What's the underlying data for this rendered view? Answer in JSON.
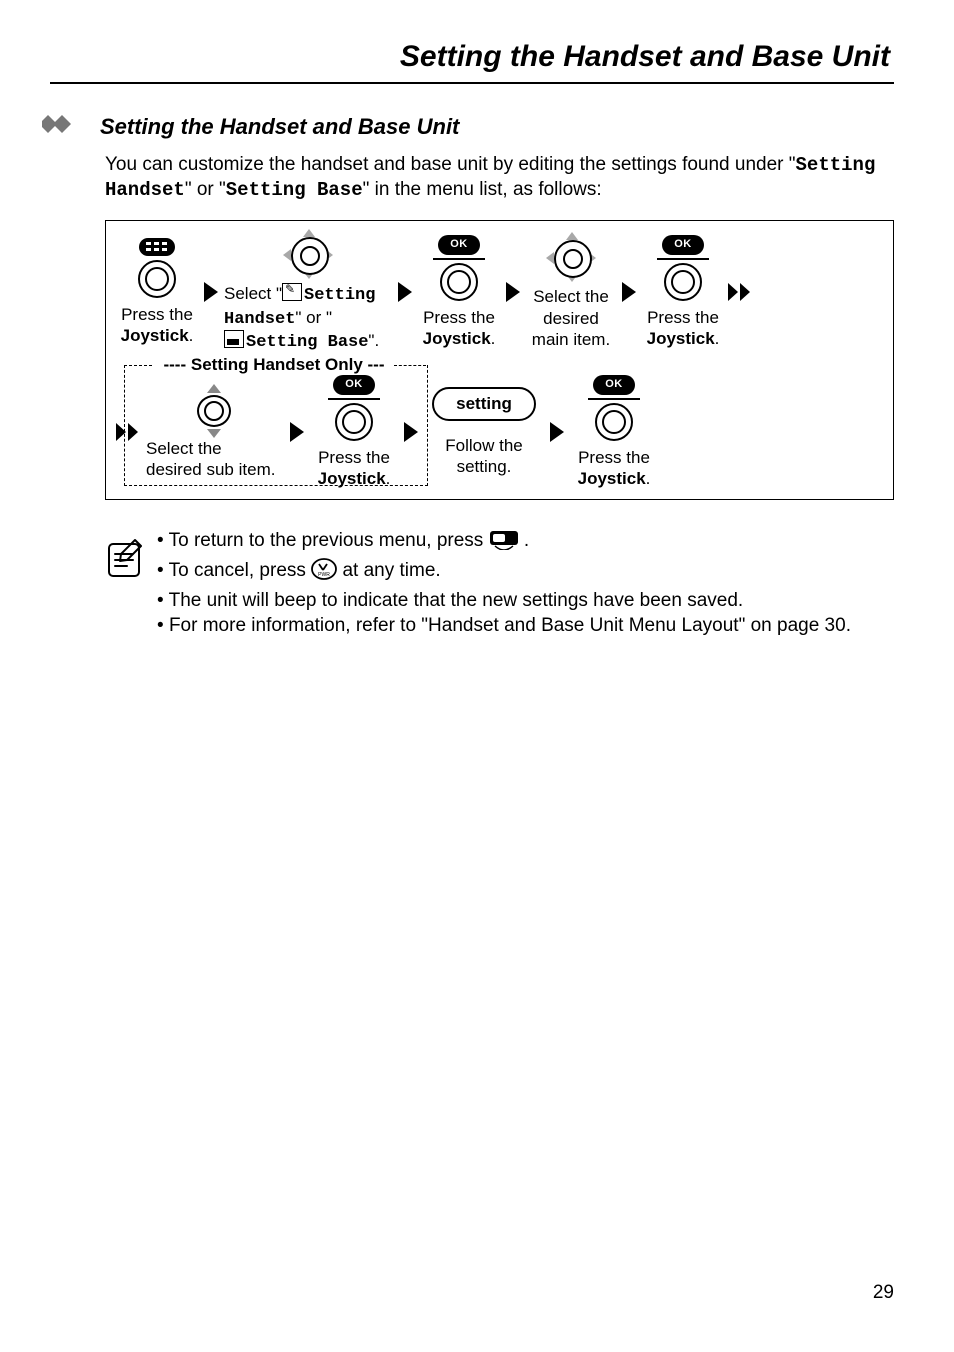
{
  "page": {
    "running_title": "Setting the Handset and Base Unit",
    "number": "29"
  },
  "section": {
    "heading": "Setting the Handset and Base Unit",
    "intro_part1": "You can customize the handset and base unit by editing the settings found under \"",
    "intro_mono1": "Setting Handset",
    "intro_part2": "\" or \"",
    "intro_mono2": "Setting Base",
    "intro_part3": "\" in the menu list, as follows:"
  },
  "flow": {
    "step1_line1": "Press the",
    "step1_line2": "Joystick",
    "step1_line3": ".",
    "step2_before": "Select \"",
    "step2_mono1": "Setting Handset",
    "step2_mid": "\" or \"",
    "step2_mono2": "Setting Base",
    "step2_after": "\".",
    "step3_line1": "Press the",
    "step3_line2": "Joystick",
    "step3_line3": ".",
    "step4_line1": "Select the",
    "step4_line2": "desired",
    "step4_line3": "main item.",
    "step5_line1": "Press the",
    "step5_line2": "Joystick",
    "step5_line3": ".",
    "handset_only_label": "Setting Handset Only",
    "step6_line1": "Select the",
    "step6_line2": "desired sub item.",
    "step7_line1": "Press the",
    "step7_line2": "Joystick",
    "step7_line3": ".",
    "setting_pill": "setting",
    "step8_line1": "Follow the",
    "step8_line2": "setting.",
    "step9_line1": "Press the",
    "step9_line2": "Joystick",
    "step9_line3": ".",
    "ok_label": "OK"
  },
  "notes": {
    "n1": "To return to the previous menu, press ",
    "n1_end": ".",
    "n2_a": "To cancel, press ",
    "n2_b": " at any time.",
    "n3": "The unit will beep to indicate that the new settings have been saved.",
    "n4": "For more information, refer to \"Handset and Base Unit Menu Layout\" on page 30."
  }
}
